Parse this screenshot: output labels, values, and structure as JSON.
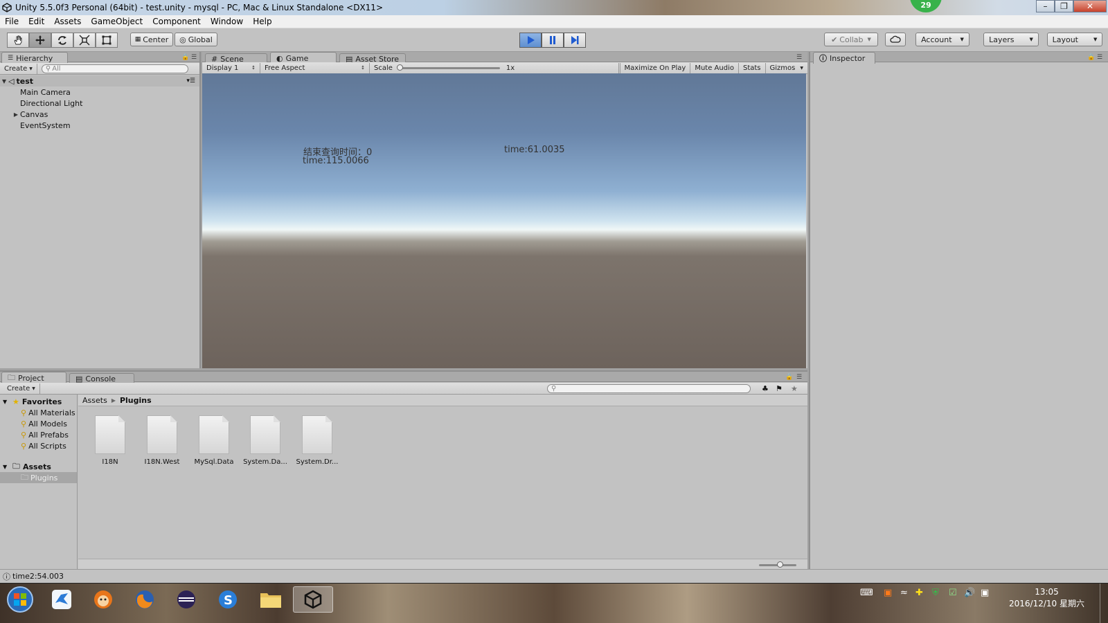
{
  "window": {
    "title": "Unity 5.5.0f3 Personal (64bit) - test.unity - mysql - PC, Mac & Linux Standalone <DX11>",
    "badge": "29"
  },
  "menu": [
    "File",
    "Edit",
    "Assets",
    "GameObject",
    "Component",
    "Window",
    "Help"
  ],
  "toolbar": {
    "center_label": "Center",
    "global_label": "Global",
    "collab_label": "Collab",
    "account_label": "Account",
    "layers_label": "Layers",
    "layout_label": "Layout"
  },
  "hierarchy": {
    "tab_label": "Hierarchy",
    "create_label": "Create",
    "search_placeholder": "All",
    "scene_name": "test",
    "items": [
      "Main Camera",
      "Directional Light",
      "Canvas",
      "EventSystem"
    ]
  },
  "game_panel": {
    "tabs": [
      "Scene",
      "Game",
      "Asset Store"
    ],
    "display": "Display 1",
    "aspect": "Free Aspect",
    "scale_label": "Scale",
    "scale_value": "1x",
    "maximize": "Maximize On Play",
    "mute": "Mute Audio",
    "stats": "Stats",
    "gizmos": "Gizmos",
    "texts": [
      "结束查询时间：0",
      "time:115.0066",
      "time:61.0035"
    ]
  },
  "inspector": {
    "tab_label": "Inspector"
  },
  "project": {
    "tabs": [
      "Project",
      "Console"
    ],
    "create_label": "Create",
    "favorites_label": "Favorites",
    "favorites": [
      "All Materials",
      "All Models",
      "All Prefabs",
      "All Scripts"
    ],
    "assets_label": "Assets",
    "folders": [
      "Plugins"
    ],
    "breadcrumb": [
      "Assets",
      "Plugins"
    ],
    "files": [
      "I18N",
      "I18N.West",
      "MySql.Data",
      "System.Da...",
      "System.Dr..."
    ]
  },
  "status": {
    "message": "time2:54.003"
  },
  "taskbar": {
    "time": "13:05",
    "date": "2016/12/10 星期六"
  }
}
